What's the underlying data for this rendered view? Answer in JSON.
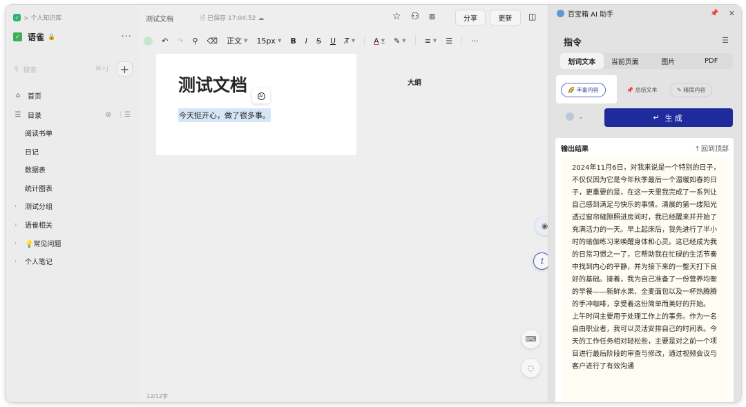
{
  "sidebar": {
    "breadcrumb": "> 个人知识库",
    "kb_name": "语雀",
    "kb_lock": "🔒",
    "more": "···",
    "search_placeholder": "搜索",
    "search_shortcut": "⌘+J",
    "add": "+",
    "home": "首页",
    "toc": "目录",
    "items": [
      "阅读书单",
      "日记",
      "数据表",
      "统计图表"
    ],
    "groups": [
      "测试分组",
      "语雀相关",
      "💡常见问题",
      "个人笔记"
    ]
  },
  "editor": {
    "tab_title": "测试文档",
    "saved_status": "已保存 17:04:52",
    "share": "分享",
    "update": "更新",
    "toolbar": {
      "style": "正文",
      "font_size": "15px",
      "bold": "B",
      "italic": "I",
      "strike": "S",
      "underline": "U"
    },
    "doc_heading": "测试文档",
    "ai_badge": "AI",
    "paragraph": "今天挺开心，做了很多事。",
    "outline": "大纲",
    "word_count": "12/12字"
  },
  "assistant": {
    "title": "百宝箱 AI 助手",
    "command_title": "指令",
    "tabs": [
      "划词文本",
      "当前页面",
      "图片",
      "PDF"
    ],
    "active_tab": 0,
    "chips": [
      "🌈 丰富内容",
      "📌 总结文本",
      "✎ 精简内容"
    ],
    "generate": "生成",
    "result_label": "输出结果",
    "back_to_top": "回到顶部",
    "result_paragraphs": [
      "2024年11月6日，对我来说是一个特别的日子，不仅仅因为它是今年秋季最后一个温暖如春的日子，更重要的是，在这一天里我完成了一系列让自己感到满足与快乐的事情。清晨的第一缕阳光透过窗帘缝隙照进房间时，我已经醒来并开始了充满活力的一天。早上起床后，我先进行了半小时的瑜伽练习来唤醒身体和心灵。这已经成为我的日常习惯之一了，它帮助我在忙碌的生活节奏中找到内心的平静，并为接下来的一整天打下良好的基础。接着，我为自己准备了一份营养均衡的早餐——新鲜水果、全麦面包以及一杯热腾腾的手冲咖啡，享受着这份简单而美好的开始。",
      "上午时间主要用于处理工作上的事务。作为一名自由职业者，我可以灵活安排自己的时间表。今天的工作任务相对轻松些，主要是对之前一个项目进行最后阶段的审查与修改，通过视频会议与客户进行了有效沟通"
    ]
  }
}
